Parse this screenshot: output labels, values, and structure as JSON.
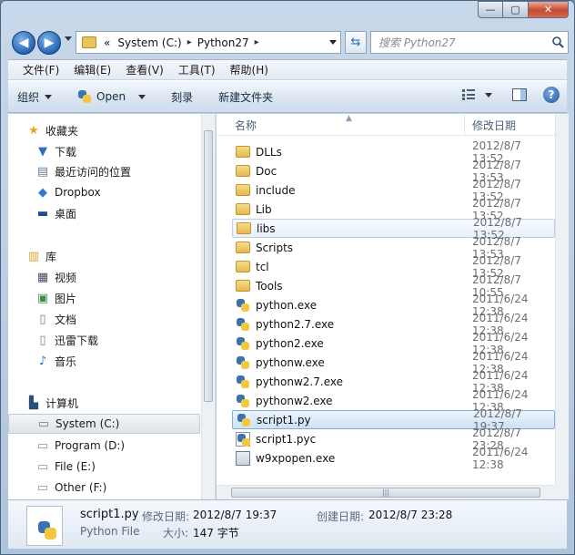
{
  "window": {
    "minimize_glyph": "—",
    "maximize_glyph": "▢",
    "close_glyph": "✕"
  },
  "address": {
    "overflow": "«",
    "parts": [
      "System (C:)",
      "Python27"
    ],
    "separator": "▸"
  },
  "search": {
    "placeholder": "搜索 Python27"
  },
  "menu": [
    "文件(F)",
    "编辑(E)",
    "查看(V)",
    "工具(T)",
    "帮助(H)"
  ],
  "commands": {
    "organize": "组织",
    "open": "Open",
    "burn": "刻录",
    "new_folder": "新建文件夹"
  },
  "help_glyph": "?",
  "navpane": {
    "favorites": {
      "label": "收藏夹",
      "items": [
        "下载",
        "最近访问的位置",
        "Dropbox",
        "桌面"
      ]
    },
    "libraries": {
      "label": "库",
      "items": [
        "视频",
        "图片",
        "文档",
        "迅雷下载",
        "音乐"
      ]
    },
    "computer": {
      "label": "计算机",
      "items": [
        "System (C:)",
        "Program (D:)",
        "File (E:)",
        "Other (F:)"
      ]
    }
  },
  "columns": {
    "name": "名称",
    "date": "修改日期"
  },
  "files": [
    {
      "name": "DLLs",
      "date": "2012/8/7 13:52",
      "type": "folder"
    },
    {
      "name": "Doc",
      "date": "2012/8/7 13:53",
      "type": "folder"
    },
    {
      "name": "include",
      "date": "2012/8/7 13:52",
      "type": "folder"
    },
    {
      "name": "Lib",
      "date": "2012/8/7 13:52",
      "type": "folder"
    },
    {
      "name": "libs",
      "date": "2012/8/7 13:52",
      "type": "folder"
    },
    {
      "name": "Scripts",
      "date": "2012/8/7 13:53",
      "type": "folder"
    },
    {
      "name": "tcl",
      "date": "2012/8/7 13:52",
      "type": "folder"
    },
    {
      "name": "Tools",
      "date": "2012/8/7 10:55",
      "type": "folder"
    },
    {
      "name": "python.exe",
      "date": "2011/6/24 12:38",
      "type": "py"
    },
    {
      "name": "python2.7.exe",
      "date": "2011/6/24 12:38",
      "type": "py"
    },
    {
      "name": "python2.exe",
      "date": "2011/6/24 12:38",
      "type": "py"
    },
    {
      "name": "pythonw.exe",
      "date": "2011/6/24 12:38",
      "type": "py"
    },
    {
      "name": "pythonw2.7.exe",
      "date": "2011/6/24 12:38",
      "type": "py"
    },
    {
      "name": "pythonw2.exe",
      "date": "2011/6/24 12:38",
      "type": "py"
    },
    {
      "name": "script1.py",
      "date": "2012/8/7 19:37",
      "type": "py"
    },
    {
      "name": "script1.pyc",
      "date": "2012/8/7 23:28",
      "type": "pyc"
    },
    {
      "name": "w9xpopen.exe",
      "date": "2011/6/24 12:38",
      "type": "exe"
    }
  ],
  "hover_row": "libs",
  "selected_row": "script1.py",
  "details": {
    "name": "script1.py",
    "type": "Python File",
    "modified_label": "修改日期:",
    "modified_value": "2012/8/7 19:37",
    "created_label": "创建日期:",
    "created_value": "2012/8/7 23:28",
    "size_label": "大小:",
    "size_value": "147 字节"
  },
  "scroll_grip": "|||"
}
